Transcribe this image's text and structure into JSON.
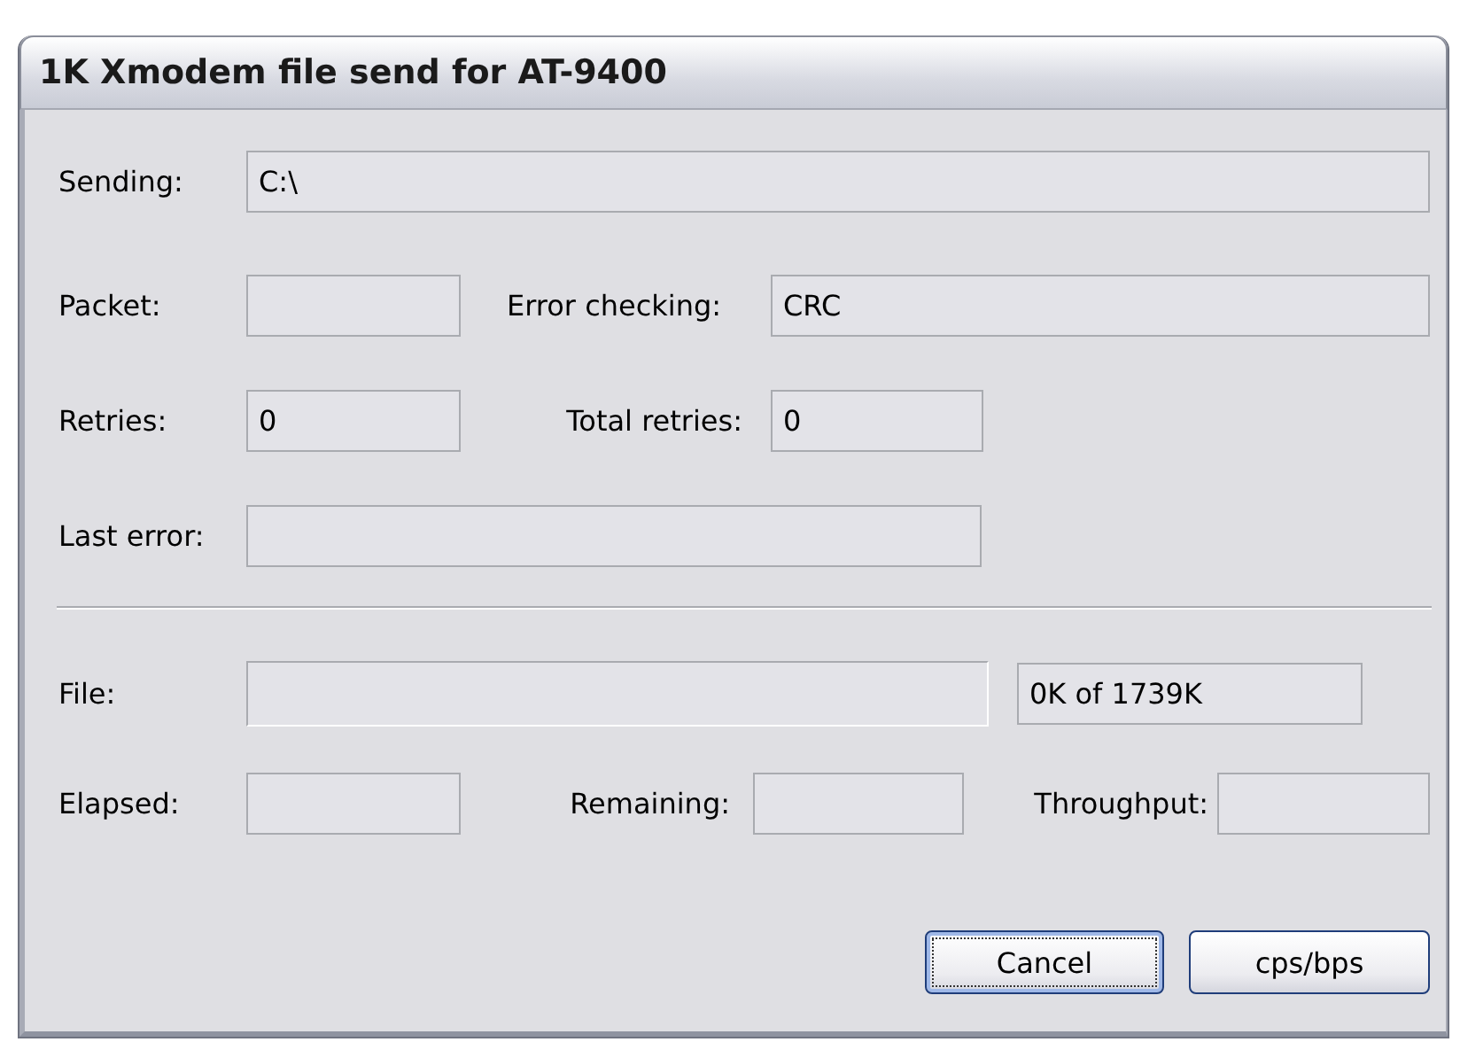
{
  "window": {
    "title": "1K Xmodem file send for AT-9400"
  },
  "sending": {
    "label": "Sending:",
    "value": "C:\\"
  },
  "packet": {
    "label": "Packet:"
  },
  "error_checking": {
    "label": "Error checking:",
    "value": "CRC"
  },
  "retries": {
    "label": "Retries:",
    "value": "0"
  },
  "total_retries": {
    "label": "Total retries:",
    "value": "0"
  },
  "last_error": {
    "label": "Last error:"
  },
  "file": {
    "label": "File:",
    "level": 0
  },
  "file_size": {
    "value": "0K of 1739K"
  },
  "elapsed": {
    "label": "Elapsed:"
  },
  "remaining": {
    "label": "Remaining:"
  },
  "throughput": {
    "label": "Throughput:"
  },
  "buttons": [
    {
      "label": "Cancel",
      "focused": true
    },
    {
      "label": "cps/bps",
      "focused": false
    }
  ]
}
